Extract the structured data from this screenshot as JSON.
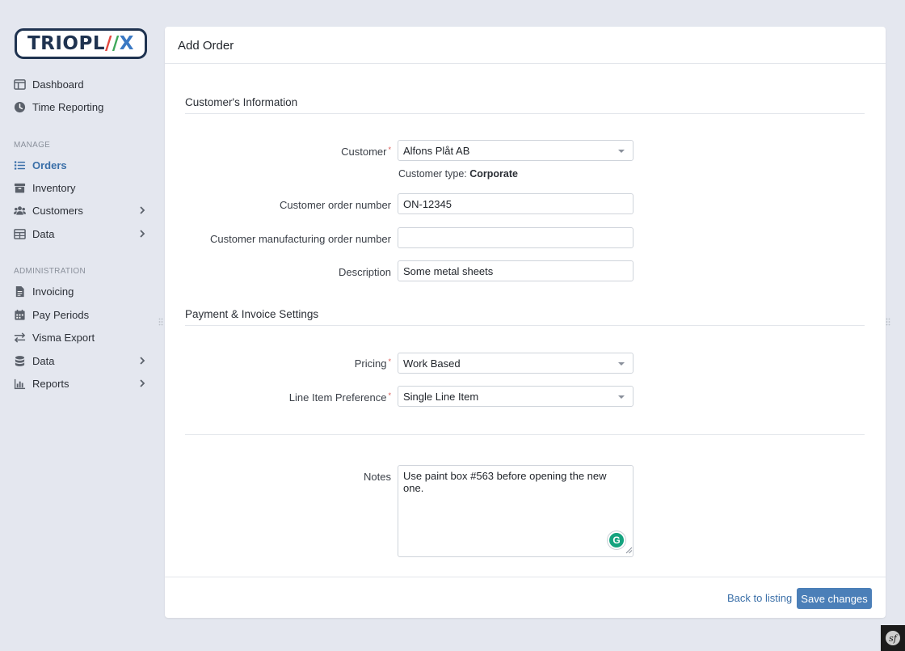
{
  "brand": {
    "logo_left": "TRIOPL",
    "logo_right": "X"
  },
  "sidebar": {
    "top_items": [
      {
        "label": "Dashboard"
      },
      {
        "label": "Time Reporting"
      }
    ],
    "manage_header": "MANAGE",
    "manage_items": [
      {
        "label": "Orders",
        "active": true
      },
      {
        "label": "Inventory"
      },
      {
        "label": "Customers"
      },
      {
        "label": "Data"
      }
    ],
    "admin_header": "ADMINISTRATION",
    "admin_items": [
      {
        "label": "Invoicing"
      },
      {
        "label": "Pay Periods"
      },
      {
        "label": "Visma Export"
      },
      {
        "label": "Data"
      },
      {
        "label": "Reports"
      }
    ]
  },
  "page": {
    "title": "Add Order"
  },
  "customer_section": {
    "title": "Customer's Information",
    "customer_label": "Customer",
    "customer_value": "Alfons Plåt AB",
    "customer_type_prefix": "Customer type:",
    "customer_type_value": "Corporate",
    "order_number_label": "Customer order number",
    "order_number_value": "ON-12345",
    "mfg_order_label": "Customer manufacturing order number",
    "mfg_order_value": "",
    "description_label": "Description",
    "description_value": "Some metal sheets"
  },
  "payment_section": {
    "title": "Payment & Invoice Settings",
    "pricing_label": "Pricing",
    "pricing_value": "Work Based",
    "line_item_label": "Line Item Preference",
    "line_item_value": "Single Line Item"
  },
  "notes": {
    "label": "Notes",
    "value": "Use paint box #563 before opening the new one."
  },
  "footer": {
    "back_label": "Back to listing",
    "save_label": "Save changes"
  },
  "colors": {
    "accent": "#3a6fa8",
    "button": "#4b7fb8",
    "background": "#e4e7ef",
    "required": "#d9534f"
  },
  "icons": {
    "dashboard": "columns-icon",
    "time": "clock-icon",
    "orders": "list-icon",
    "inventory": "archive-icon",
    "customers": "users-icon",
    "data": "table-icon",
    "invoicing": "file-icon",
    "pay_periods": "calendar-icon",
    "visma": "arrows-exchange-icon",
    "admin_data": "database-icon",
    "reports": "bar-chart-icon"
  }
}
